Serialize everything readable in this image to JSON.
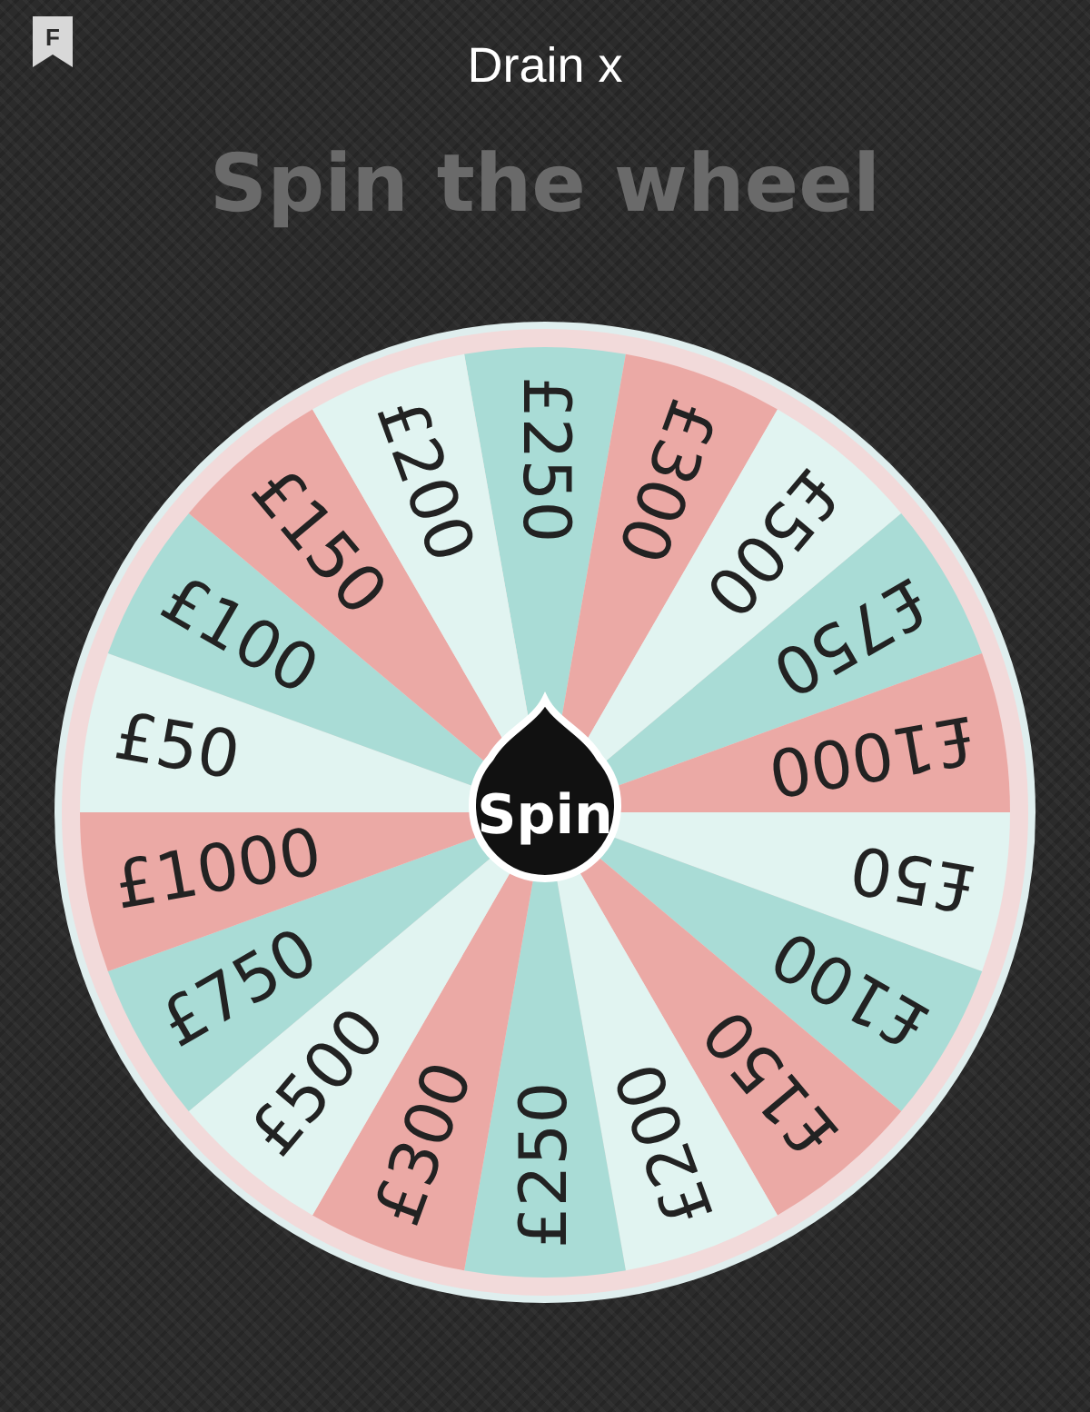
{
  "header": {
    "badge": "F",
    "title": "Drain x"
  },
  "heading": "Spin the wheel",
  "wheel": {
    "spin_label": "Spin",
    "segments": [
      {
        "label": "£250",
        "color": "#a9dcd6"
      },
      {
        "label": "£300",
        "color": "#eba9a5"
      },
      {
        "label": "£500",
        "color": "#e1f4f1"
      },
      {
        "label": "£750",
        "color": "#a9dcd6"
      },
      {
        "label": "£1000",
        "color": "#eba9a5"
      },
      {
        "label": "£50",
        "color": "#e1f4f1"
      },
      {
        "label": "£100",
        "color": "#a9dcd6"
      },
      {
        "label": "£150",
        "color": "#eba9a5"
      },
      {
        "label": "£200",
        "color": "#e1f4f1"
      },
      {
        "label": "£250",
        "color": "#a9dcd6"
      },
      {
        "label": "£300",
        "color": "#eba9a5"
      },
      {
        "label": "£500",
        "color": "#e1f4f1"
      },
      {
        "label": "£750",
        "color": "#a9dcd6"
      },
      {
        "label": "£1000",
        "color": "#eba9a5"
      },
      {
        "label": "£50",
        "color": "#e1f4f1"
      },
      {
        "label": "£100",
        "color": "#a9dcd6"
      },
      {
        "label": "£150",
        "color": "#eba9a5"
      },
      {
        "label": "£200",
        "color": "#e1f4f1"
      }
    ]
  }
}
